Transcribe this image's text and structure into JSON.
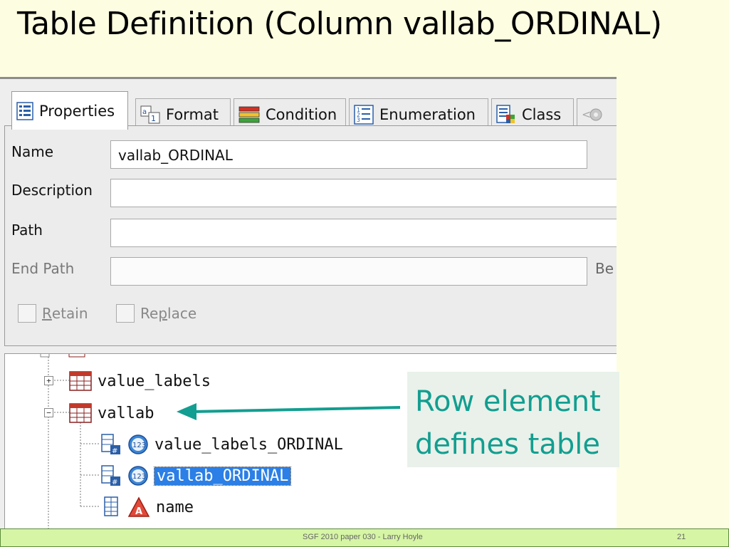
{
  "slide": {
    "title": "Table Definition (Column vallab_ORDINAL)",
    "footer_text": "SGF 2010 paper  030  - Larry Hoyle",
    "page_number": "21"
  },
  "tabs": [
    {
      "label": "Properties",
      "icon": "properties-icon",
      "active": true
    },
    {
      "label": "Format",
      "icon": "format-icon",
      "active": false
    },
    {
      "label": "Condition",
      "icon": "condition-icon",
      "active": false
    },
    {
      "label": "Enumeration",
      "icon": "enumeration-icon",
      "active": false
    },
    {
      "label": "Class",
      "icon": "class-icon",
      "active": false
    }
  ],
  "properties": {
    "name_label": "Name",
    "name_value": "vallab_ORDINAL",
    "description_label": "Description",
    "description_value": "",
    "path_label": "Path",
    "path_value": "",
    "end_path_label": "End Path",
    "end_path_value": "",
    "truncated_label": "Be",
    "retain_mnemonic": "R",
    "retain_rest": "etain",
    "replace_pre": "Re",
    "replace_mnemonic": "p",
    "replace_rest": "lace"
  },
  "tree": {
    "nodes": [
      {
        "label": "value_labels",
        "icon": "table-icon",
        "expander": "+"
      },
      {
        "label": "vallab",
        "icon": "table-icon",
        "expander": "-"
      },
      {
        "label": "value_labels_ORDINAL",
        "icon": "column-icon",
        "type_icon": "numeric-icon"
      },
      {
        "label": "vallab_ORDINAL",
        "icon": "column-icon",
        "type_icon": "numeric-icon",
        "selected": true
      },
      {
        "label": "name",
        "icon": "column-icon",
        "type_icon": "character-icon"
      }
    ]
  },
  "callout": {
    "line1": "Row element",
    "line2": "defines table",
    "color": "#129e90"
  },
  "colors": {
    "slide_background": "#fdfde1",
    "selection": "#2b7fe6",
    "footer_background": "#d6f5a5"
  }
}
